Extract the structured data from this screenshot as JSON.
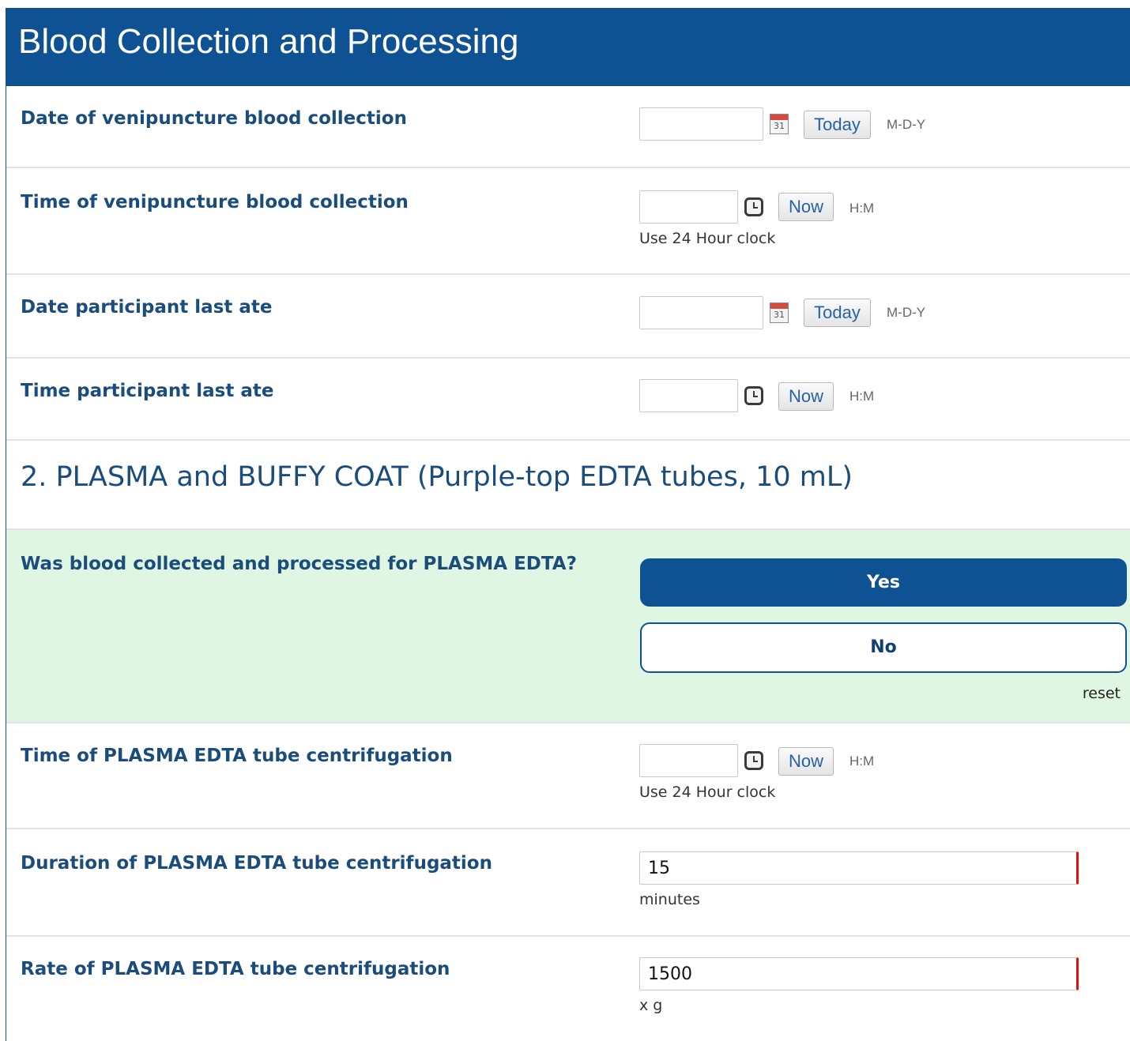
{
  "header": {
    "title": "Blood Collection and Processing"
  },
  "fields": {
    "date_venipuncture": {
      "label": "Date of venipuncture blood collection",
      "value": "",
      "button": "Today",
      "format": "M-D-Y",
      "icon": "calendar-icon",
      "icon_text": "31"
    },
    "time_venipuncture": {
      "label": "Time of venipuncture blood collection",
      "value": "",
      "button": "Now",
      "format": "H:M",
      "note": "Use 24 Hour clock",
      "icon": "clock-icon"
    },
    "date_last_ate": {
      "label": "Date participant last ate",
      "value": "",
      "button": "Today",
      "format": "M-D-Y",
      "icon": "calendar-icon",
      "icon_text": "31"
    },
    "time_last_ate": {
      "label": "Time participant last ate",
      "value": "",
      "button": "Now",
      "format": "H:M",
      "icon": "clock-icon"
    }
  },
  "section2": {
    "title": "2. PLASMA and BUFFY COAT (Purple-top EDTA tubes, 10 mL)"
  },
  "plasma_question": {
    "label": "Was blood collected and processed for PLASMA EDTA?",
    "options": [
      "Yes",
      "No"
    ],
    "selected": "Yes",
    "reset": "reset"
  },
  "plasma_fields": {
    "time_centrifugation": {
      "label": "Time of PLASMA EDTA tube centrifugation",
      "value": "",
      "button": "Now",
      "format": "H:M",
      "note": "Use 24 Hour clock",
      "icon": "clock-icon"
    },
    "duration_centrifugation": {
      "label": "Duration of PLASMA EDTA tube centrifugation",
      "value": "15",
      "unit": "minutes"
    },
    "rate_centrifugation": {
      "label": "Rate of PLASMA EDTA tube centrifugation",
      "value": "1500",
      "unit": "x g"
    }
  },
  "colors": {
    "header_bg": "#0e5294",
    "label": "#1a4c7c",
    "highlight_bg": "#dff6e2",
    "required_marker": "#e01010"
  }
}
